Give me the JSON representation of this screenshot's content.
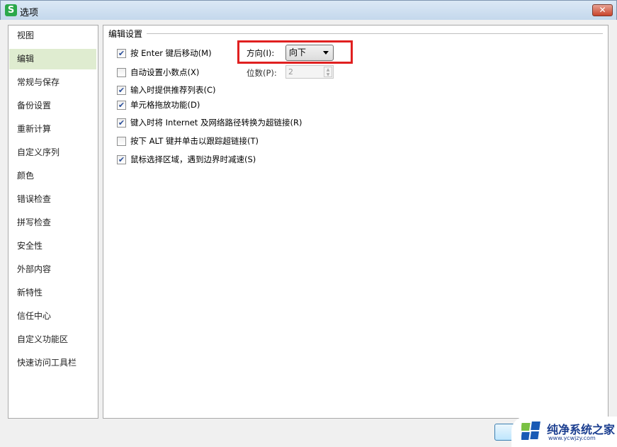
{
  "window": {
    "title": "选项",
    "app_icon": "S",
    "close_label": "✕"
  },
  "sidebar": {
    "items": [
      {
        "label": "视图"
      },
      {
        "label": "编辑",
        "selected": true
      },
      {
        "label": "常规与保存"
      },
      {
        "label": "备份设置"
      },
      {
        "label": "重新计算"
      },
      {
        "label": "自定义序列"
      },
      {
        "label": "颜色"
      },
      {
        "label": "错误检查"
      },
      {
        "label": "拼写检查"
      },
      {
        "label": "安全性"
      },
      {
        "label": "外部内容"
      },
      {
        "label": "新特性"
      },
      {
        "label": "信任中心"
      },
      {
        "label": "自定义功能区"
      },
      {
        "label": "快速访问工具栏"
      }
    ]
  },
  "main": {
    "section_title": "编辑设置",
    "options": [
      {
        "label": "按 Enter 键后移动(M)",
        "checked": true
      },
      {
        "label": "自动设置小数点(X)",
        "checked": false
      },
      {
        "label": "输入时提供推荐列表(C)",
        "checked": true
      },
      {
        "label": "单元格拖放功能(D)",
        "checked": true
      },
      {
        "label": "键入时将 Internet 及网络路径转换为超链接(R)",
        "checked": true
      },
      {
        "label": "按下 ALT 键并单击以跟踪超链接(T)",
        "checked": false
      },
      {
        "label": "鼠标选择区域，遇到边界时减速(S)",
        "checked": true
      }
    ],
    "direction_label": "方向(I):",
    "direction_value": "向下",
    "digits_label": "位数(P):",
    "digits_value": "2"
  },
  "watermark": {
    "text": "纯净系统之家",
    "url": "www.ycwjzy.com"
  },
  "colors": {
    "highlight": "#e02020",
    "selected": "#dfecd0"
  }
}
